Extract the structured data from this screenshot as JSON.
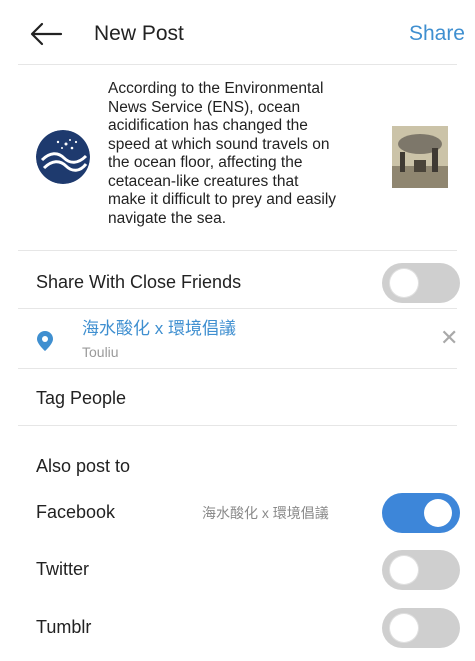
{
  "header": {
    "title": "New Post",
    "share_label": "Share",
    "back_icon": "arrow-left-icon"
  },
  "post": {
    "caption": "According to the Environmental\nNews Service (ENS), ocean\nacidification has changed the\nspeed at which sound travels on\nthe ocean floor, affecting the\ncetacean-like creatures that\nmake it difficult to prey and easily\nnavigate the sea."
  },
  "close_friends": {
    "label": "Share With Close Friends",
    "enabled": false
  },
  "location": {
    "name": "海水酸化 x 環境倡議",
    "subtitle": "Touliu",
    "clear_icon": "close-icon"
  },
  "tag_people": {
    "label": "Tag People"
  },
  "also_post_to": {
    "heading": "Also post to",
    "targets": [
      {
        "label": "Facebook",
        "account": "海水酸化 x 環境倡議",
        "enabled": true
      },
      {
        "label": "Twitter",
        "enabled": false
      },
      {
        "label": "Tumblr",
        "enabled": false
      }
    ]
  },
  "colors": {
    "accent": "#3f8fd0",
    "toggle_on": "#3d86d9",
    "toggle_off": "#cfcfcf"
  }
}
